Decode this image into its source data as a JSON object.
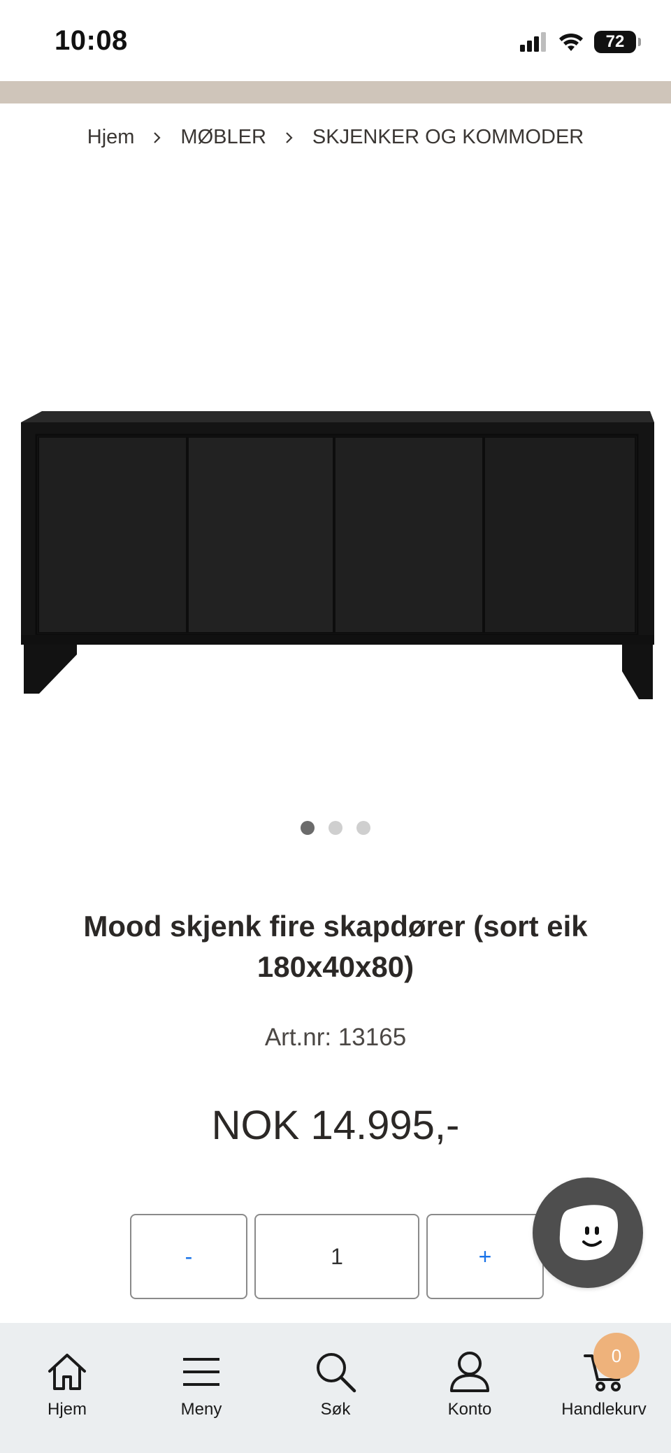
{
  "status_bar": {
    "time": "10:08",
    "battery": "72"
  },
  "breadcrumb": {
    "items": [
      "Hjem",
      "MØBLER",
      "SKJENKER OG KOMMODER"
    ],
    "separator": ">"
  },
  "product": {
    "image_alt_icon": "sideboard-image",
    "gallery": {
      "count": 3,
      "active_index": 0
    },
    "title": "Mood skjenk fire skapdører (sort eik 180x40x80)",
    "art_label": "Art.nr: 13165",
    "price": "NOK 14.995,-"
  },
  "quantity": {
    "decrement": "-",
    "value": "1",
    "increment": "+"
  },
  "chat": {
    "icon": "smiley-chat-icon"
  },
  "bottom_nav": {
    "items": [
      {
        "label": "Hjem",
        "icon": "home-icon"
      },
      {
        "label": "Meny",
        "icon": "menu-icon"
      },
      {
        "label": "Søk",
        "icon": "search-icon"
      },
      {
        "label": "Konto",
        "icon": "user-icon"
      },
      {
        "label": "Handlekurv",
        "icon": "cart-icon"
      }
    ],
    "cart_count": "0"
  },
  "colors": {
    "top_band": "#cfc5ba",
    "nav_bg": "#ebeef0",
    "cart_badge": "#eeb27b",
    "accent_blue": "#1a73e8",
    "chat_bubble": "#4e4e4e"
  }
}
